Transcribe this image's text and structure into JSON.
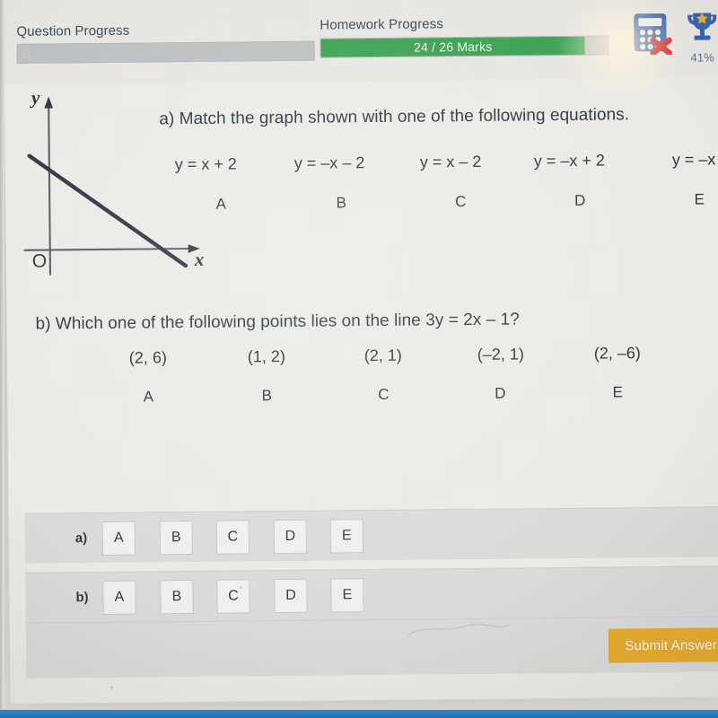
{
  "header": {
    "question_progress": {
      "label": "Question Progress",
      "value_text": "0",
      "percent": 0
    },
    "homework_progress": {
      "label": "Homework Progress",
      "value_text": "24 / 26 Marks",
      "marks_earned": 24,
      "marks_total": 26,
      "percent": 92
    },
    "calculator_icon": "calculator-not-allowed-icon",
    "trophy_icon": "trophy-icon",
    "trophy_percent": "41%"
  },
  "question": {
    "part_a": {
      "prompt": "a) Match the graph shown with one of the following equations.",
      "options": [
        {
          "letter": "A",
          "text": "y = x + 2"
        },
        {
          "letter": "B",
          "text": "y = –x – 2"
        },
        {
          "letter": "C",
          "text": "y = x – 2"
        },
        {
          "letter": "D",
          "text": "y = –x + 2"
        },
        {
          "letter": "E",
          "text": "y = –x"
        }
      ],
      "graph": {
        "x_axis_label": "x",
        "y_axis_label": "y",
        "origin_label": "O",
        "description": "straight line with negative gradient and positive y-intercept"
      }
    },
    "part_b": {
      "prompt": "b) Which one of the following points lies on the line 3y = 2x – 1?",
      "options": [
        {
          "letter": "A",
          "text": "(2, 6)"
        },
        {
          "letter": "B",
          "text": "(1, 2)"
        },
        {
          "letter": "C",
          "text": "(2, 1)"
        },
        {
          "letter": "D",
          "text": "(–2, 1)"
        },
        {
          "letter": "E",
          "text": "(2, –6)"
        }
      ]
    }
  },
  "answer_panel": {
    "rows": [
      {
        "label": "a)",
        "choices": [
          "A",
          "B",
          "C",
          "D",
          "E"
        ],
        "selected": null
      },
      {
        "label": "b)",
        "choices": [
          "A",
          "B",
          "C",
          "D",
          "E"
        ],
        "selected": null
      }
    ],
    "submit_label": "Submit Answer"
  },
  "colors": {
    "progress_green": "#3aa350",
    "progress_track": "#bfc2c3",
    "submit_amber": "#e8ac2c",
    "icon_blue": "#3a63ae",
    "star_gold": "#e8b13a",
    "cross_red": "#d62828",
    "text_dark": "#27333b"
  }
}
